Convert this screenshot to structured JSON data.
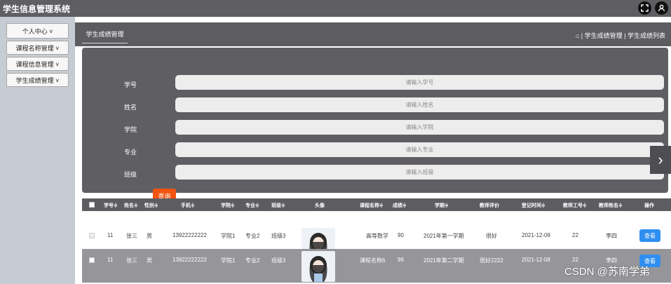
{
  "app": {
    "title": "学生信息管理系统",
    "icons": [
      "fullscreen-icon",
      "user-icon"
    ]
  },
  "sidebar": {
    "items": [
      {
        "label": "个人中心 ˅"
      },
      {
        "label": "课程名称管理 ˅"
      },
      {
        "label": "课程信息管理 ˅"
      },
      {
        "label": "学生成绩管理 ˅"
      }
    ]
  },
  "crumbbar": {
    "tab_label": "学生成绩管理",
    "breadcrumb": "⌂ | 学生成绩管理 | 学生成绩列表"
  },
  "search": {
    "fields": [
      {
        "label": "学号",
        "placeholder": "请输入学号"
      },
      {
        "label": "姓名",
        "placeholder": "请输入姓名"
      },
      {
        "label": "学院",
        "placeholder": "请输入学院"
      },
      {
        "label": "专业",
        "placeholder": "请输入专业"
      },
      {
        "label": "班级",
        "placeholder": "请输入班级"
      }
    ],
    "query_label": "查询"
  },
  "table": {
    "headers": [
      "学号≑",
      "姓名≑",
      "性别≑",
      "手机≑",
      "学院≑",
      "专业≑",
      "班级≑",
      "头像",
      "课程名称≑",
      "成绩≑",
      "学期≑",
      "教师评价",
      "登记时间≑",
      "教师工号≑",
      "教师姓名≑",
      "操作"
    ],
    "rows": [
      {
        "cells": [
          "11",
          "张三",
          "男",
          "13922222222",
          "学院1",
          "专业2",
          "班级3",
          "",
          "高等数学",
          "90",
          "2021年第一学期",
          "很好",
          "2021-12-08",
          "22",
          "李四"
        ],
        "action": "查看"
      },
      {
        "cells": [
          "11",
          "张三",
          "男",
          "13922222222",
          "学院1",
          "专业2",
          "班级3",
          "",
          "课程名称6",
          "96",
          "2021年第二学期",
          "很好2222",
          "2021-12-08",
          "22",
          "李四"
        ],
        "action": "查看"
      }
    ]
  },
  "watermark": "CSDN @苏南学弟",
  "colors": {
    "topbar": "#5f5f63",
    "sidebar": "#c5ccd3",
    "panel": "#5f5f63",
    "query_button": "#f2530f",
    "view_button": "#2f8ff0"
  }
}
